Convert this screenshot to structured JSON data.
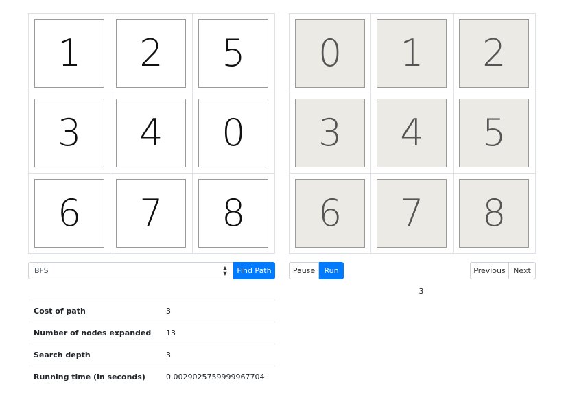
{
  "current_board": {
    "tiles": [
      "1",
      "2",
      "5",
      "3",
      "4",
      "0",
      "6",
      "7",
      "8"
    ]
  },
  "goal_board": {
    "tiles": [
      "0",
      "1",
      "2",
      "3",
      "4",
      "5",
      "6",
      "7",
      "8"
    ]
  },
  "controls": {
    "algorithm_selected": "BFS",
    "find_path_label": "Find Path",
    "pause_label": "Pause",
    "run_label": "Run",
    "previous_label": "Previous",
    "next_label": "Next"
  },
  "step_indicator": "3",
  "stats": [
    {
      "label": "Cost of path",
      "value": "3"
    },
    {
      "label": "Number of nodes expanded",
      "value": "13"
    },
    {
      "label": "Search depth",
      "value": "3"
    },
    {
      "label": "Running time (in seconds)",
      "value": "0.0029025759999967704"
    }
  ],
  "colors": {
    "primary": "#007bff",
    "goal_tile_bg": "#ebeae4"
  }
}
